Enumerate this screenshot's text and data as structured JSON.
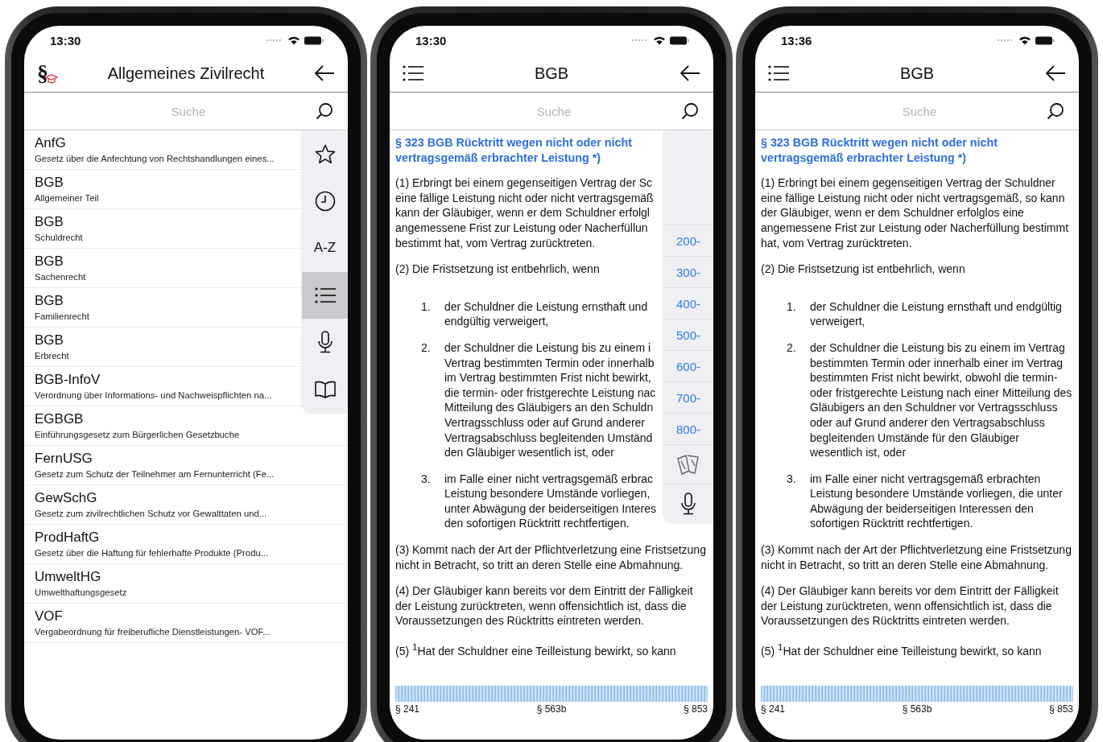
{
  "phones": [
    {
      "kind": "list",
      "time": "13:30",
      "header": {
        "logo_text": "§",
        "title": "Allgemeines Zivilrecht"
      },
      "search": {
        "placeholder": "Suche"
      },
      "items": [
        {
          "abbr": "AnfG",
          "subtitle": "Gesetz über die Anfechtung von Rechtshandlungen eines..."
        },
        {
          "abbr": "BGB",
          "subtitle": "Allgemeiner Teil"
        },
        {
          "abbr": "BGB",
          "subtitle": "Schuldrecht"
        },
        {
          "abbr": "BGB",
          "subtitle": "Sachenrecht"
        },
        {
          "abbr": "BGB",
          "subtitle": "Familienrecht"
        },
        {
          "abbr": "BGB",
          "subtitle": "Erbrecht"
        },
        {
          "abbr": "BGB-InfoV",
          "subtitle": "Verordnung über Informations- und Nachweispflichten na..."
        },
        {
          "abbr": "EGBGB",
          "subtitle": "Einführungsgesetz zum Bürgerlichen Gesetzbuche"
        },
        {
          "abbr": "FernUSG",
          "subtitle": "Gesetz zum Schutz der Teilnehmer am Fernunterricht (Fe..."
        },
        {
          "abbr": "GewSchG",
          "subtitle": "Gesetz zum zivilrechtlichen Schutz vor Gewalttaten und..."
        },
        {
          "abbr": "ProdHaftG",
          "subtitle": "Gesetz über die Haftung für fehlerhafte Produkte (Produ..."
        },
        {
          "abbr": "UmweltHG",
          "subtitle": "Umwelthaftungsgesetz"
        },
        {
          "abbr": "VOF",
          "subtitle": "Vergabeordnung für freiberufliche Dienstleistungen- VOF..."
        }
      ],
      "side_tools": [
        {
          "kind": "star",
          "selected": false
        },
        {
          "kind": "clock",
          "selected": false
        },
        {
          "kind": "label",
          "label": "A-Z",
          "selected": false
        },
        {
          "kind": "list",
          "selected": true
        },
        {
          "kind": "mic",
          "selected": false
        },
        {
          "kind": "book",
          "selected": false
        }
      ]
    },
    {
      "kind": "document",
      "time": "13:30",
      "header": {
        "title": "BGB"
      },
      "search": {
        "placeholder": "Suche"
      },
      "heading": "§ 323 BGB Rücktritt wegen nicht oder nicht vertragsgemäß erbrachter Leistung *)",
      "blocks": [
        {
          "kind": "para",
          "lines": [
            "(1) Erbringt bei einem gegenseitigen Vertrag der Sc",
            "eine fällige Leistung nicht oder nicht vertragsgemäß",
            "kann der Gläubiger, wenn er dem Schuldner erfolgl",
            "angemessene Frist zur Leistung oder Nacherfüllun",
            "bestimmt hat, vom Vertrag zurücktreten."
          ]
        },
        {
          "kind": "para",
          "lines": [
            "(2) Die Fristsetzung ist entbehrlich, wenn"
          ]
        },
        {
          "kind": "item",
          "number": "1.",
          "lines": [
            "der Schuldner die Leistung ernsthaft und",
            "endgültig verweigert,"
          ]
        },
        {
          "kind": "item",
          "number": "2.",
          "lines": [
            "der Schuldner die Leistung bis zu einem i",
            "Vertrag bestimmten Termin oder innerhalb",
            "im Vertrag bestimmten Frist nicht bewirkt,",
            "die termin- oder fristgerechte Leistung nac",
            "Mitteilung des Gläubigers an den Schuldn",
            "Vertragsschluss oder auf Grund anderer",
            "Vertragsabschluss begleitenden Umständ",
            "den Gläubiger wesentlich ist, oder"
          ]
        },
        {
          "kind": "item",
          "number": "3.",
          "lines": [
            "im Falle einer nicht vertragsgemäß erbrac",
            "Leistung besondere Umstände vorliegen,",
            "unter Abwägung der beiderseitigen Interes",
            "den sofortigen Rücktritt rechtfertigen."
          ]
        },
        {
          "kind": "para",
          "text": "(3) Kommt nach der Art der Pflichtverletzung eine Fristsetzung nicht in Betracht, so tritt an deren Stelle eine Abmahnung."
        },
        {
          "kind": "para",
          "text": "(4) Der Gläubiger kann bereits vor dem Eintritt der Fälligkeit der Leistung zurücktreten, wenn offensichtlich ist, dass die Voraussetzungen des Rücktritts eintreten werden."
        },
        {
          "kind": "para",
          "text": "(5) $^{1}$Hat der Schuldner eine Teilleistung bewirkt, so kann"
        }
      ],
      "side_tools": [
        {
          "kind": "label",
          "label": "200-",
          "selected": false
        },
        {
          "kind": "label",
          "label": "300-",
          "selected": false
        },
        {
          "kind": "label",
          "label": "400-",
          "selected": false
        },
        {
          "kind": "label",
          "label": "500-",
          "selected": false
        },
        {
          "kind": "label",
          "label": "600-",
          "selected": false
        },
        {
          "kind": "label",
          "label": "700-",
          "selected": false
        },
        {
          "kind": "label",
          "label": "800-",
          "selected": false
        },
        {
          "kind": "cards",
          "selected": false
        },
        {
          "kind": "mic",
          "selected": false
        }
      ],
      "scrubber": {
        "labels": [
          "§ 241",
          "§ 563b",
          "§ 853"
        ]
      }
    },
    {
      "kind": "document",
      "time": "13:36",
      "header": {
        "title": "BGB"
      },
      "search": {
        "placeholder": "Suche"
      },
      "heading": "§ 323 BGB Rücktritt wegen nicht oder nicht vertragsgemäß erbrachter Leistung *)",
      "blocks": [
        {
          "kind": "para",
          "text": "(1) Erbringt bei einem gegenseitigen Vertrag der Schuldner eine fällige Leistung nicht oder nicht vertragsgemäß, so kann der Gläubiger, wenn er dem Schuldner erfolglos eine angemessene Frist zur Leistung oder Nacherfüllung bestimmt hat, vom Vertrag zurücktreten."
        },
        {
          "kind": "para",
          "text": "(2) Die Fristsetzung ist entbehrlich, wenn"
        },
        {
          "kind": "item",
          "number": "1.",
          "text": "der Schuldner die Leistung ernsthaft und endgültig verweigert,"
        },
        {
          "kind": "item",
          "number": "2.",
          "text": "der Schuldner die Leistung bis zu einem im Vertrag bestimmten Termin oder innerhalb einer im Vertrag bestimmten Frist nicht bewirkt, obwohl die termin- oder fristgerechte Leistung nach einer Mitteilung des Gläubigers an den Schuldner vor Vertragsschluss oder auf Grund anderer den Vertragsabschluss begleitenden Umstände für den Gläubiger wesentlich ist, oder"
        },
        {
          "kind": "item",
          "number": "3.",
          "text": "im Falle einer nicht vertragsgemäß erbrachten Leistung besondere Umstände vorliegen, die unter Abwägung der beiderseitigen Interessen den sofortigen Rücktritt rechtfertigen."
        },
        {
          "kind": "para",
          "text": "(3) Kommt nach der Art der Pflichtverletzung eine Fristsetzung nicht in Betracht, so tritt an deren Stelle eine Abmahnung."
        },
        {
          "kind": "para",
          "text": "(4) Der Gläubiger kann bereits vor dem Eintritt der Fälligkeit der Leistung zurücktreten, wenn offensichtlich ist, dass die Voraussetzungen des Rücktritts eintreten werden."
        },
        {
          "kind": "para",
          "text": "(5) $^{1}$Hat der Schuldner eine Teilleistung bewirkt, so kann"
        }
      ],
      "scrubber": {
        "labels": [
          "§ 241",
          "§ 563b",
          "§ 853"
        ]
      }
    }
  ]
}
